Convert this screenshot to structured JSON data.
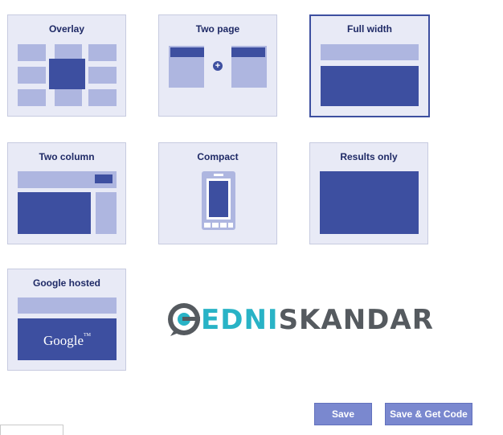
{
  "layouts": [
    {
      "id": "overlay",
      "title": "Overlay",
      "selected": false
    },
    {
      "id": "two-page",
      "title": "Two page",
      "selected": false
    },
    {
      "id": "full-width",
      "title": "Full width",
      "selected": true
    },
    {
      "id": "two-column",
      "title": "Two column",
      "selected": false
    },
    {
      "id": "compact",
      "title": "Compact",
      "selected": false
    },
    {
      "id": "results-only",
      "title": "Results only",
      "selected": false
    },
    {
      "id": "google-hosted",
      "title": "Google hosted",
      "selected": false,
      "preview_text": "Google",
      "preview_tm": "TM"
    }
  ],
  "two_page_plus_icon": "+",
  "watermark": {
    "part1": "EDNI",
    "part2": "SKANDAR"
  },
  "buttons": {
    "save": "Save",
    "save_get_code": "Save & Get Code"
  },
  "colors": {
    "dark": "#3d4fa0",
    "light": "#aeb6e0",
    "card_bg": "#e8eaf6",
    "button": "#7a88cf",
    "watermark_teal": "#29b3c6",
    "watermark_gray": "#555a5f"
  }
}
